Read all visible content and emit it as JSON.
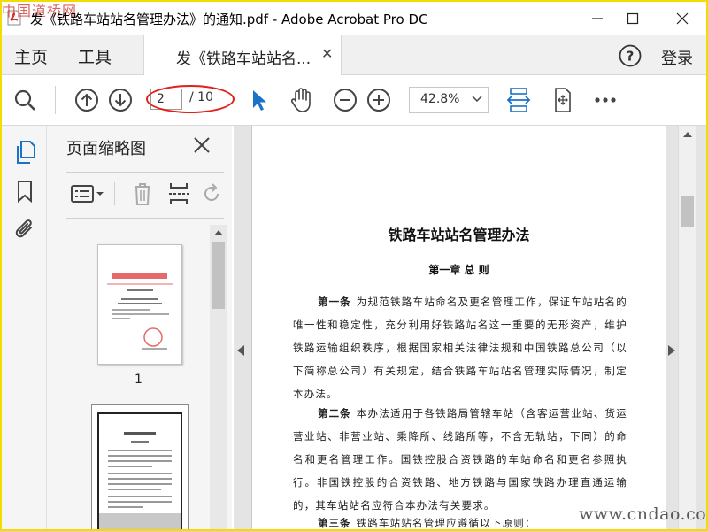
{
  "window": {
    "title": "发《铁路车站站名管理办法》的通知.pdf - Adobe Acrobat Pro DC",
    "watermark_top": "中国道桥网",
    "watermark_bottom": "www.cndao.com"
  },
  "menu": {
    "home": "主页",
    "tools": "工具",
    "doc_tab": "发《铁路车站站名...",
    "login": "登录"
  },
  "toolbar": {
    "page_current": "2",
    "page_total": "/ 10",
    "zoom": "42.8%"
  },
  "thumbnails": {
    "title": "页面缩略图",
    "page1_label": "1"
  },
  "document": {
    "title": "铁路车站站名管理办法",
    "chapter": "第一章 总 则",
    "articles": [
      {
        "heading": "第一条",
        "text": "为规范铁路车站命名及更名管理工作，保证车站站名的唯一性和稳定性，充分利用好铁路站名这一重要的无形资产，维护铁路运输组织秩序，根据国家相关法律法规和中国铁路总公司（以下简称总公司）有关规定，结合铁路车站站名管理实际情况，制定本办法。"
      },
      {
        "heading": "第二条",
        "text": "本办法适用于各铁路局管辖车站（含客运营业站、货运营业站、非营业站、乘降所、线路所等，不含无轨站，下同）的命名和更名管理工作。国铁控股合资铁路的车站命名和更名参照执行。非国铁控股的合资铁路、地方铁路与国家铁路办理直通运输的，其车站站名应符合本办法有关要求。"
      },
      {
        "heading": "第三条",
        "text": "铁路车站站名管理应遵循以下原则："
      }
    ]
  },
  "colors": {
    "accent_blue": "#1a73c8",
    "annotation_red": "#e0201a",
    "frame_yellow": "#f2dd00"
  }
}
